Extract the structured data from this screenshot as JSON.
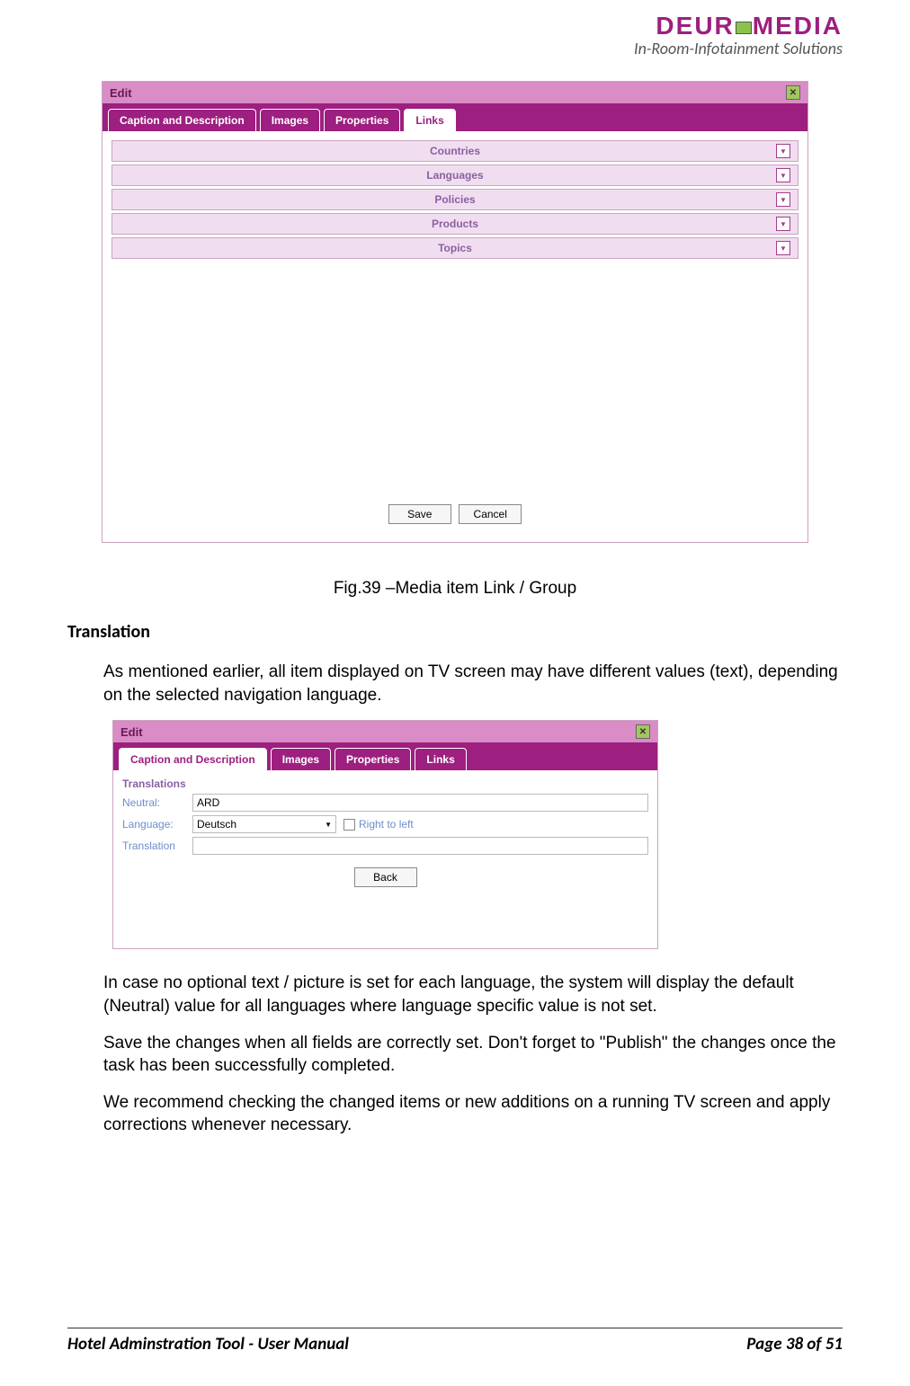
{
  "header": {
    "logo_text": "DEUR   MEDIA",
    "tagline": "In-Room-Infotainment Solutions"
  },
  "window1": {
    "title": "Edit",
    "tabs": [
      "Caption and Description",
      "Images",
      "Properties",
      "Links"
    ],
    "active_tab_index": 3,
    "link_rows": [
      "Countries",
      "Languages",
      "Policies",
      "Products",
      "Topics"
    ],
    "buttons": {
      "save": "Save",
      "cancel": "Cancel"
    }
  },
  "fig_caption": "Fig.39 –Media item Link / Group",
  "section_heading": "Translation",
  "paragraph1": "As mentioned earlier, all item displayed on TV screen may have different values (text), depending on the selected navigation language.",
  "window2": {
    "title": "Edit",
    "tabs": [
      "Caption and Description",
      "Images",
      "Properties",
      "Links"
    ],
    "active_tab_index": 0,
    "section_label": "Translations",
    "neutral_label": "Neutral:",
    "neutral_value": "ARD",
    "language_label": "Language:",
    "language_value": "Deutsch",
    "rtl_label": "Right to left",
    "translation_label": "Translation",
    "translation_value": "",
    "back_button": "Back"
  },
  "paragraph2": "In case no optional text / picture is set for each language, the system will display the default (Neutral) value for all languages where language specific value is not set.",
  "paragraph3": "Save the changes when all fields are correctly set. Don't forget to \"Publish\" the changes once the task has been successfully completed.",
  "paragraph4": "We recommend checking the changed items or new additions on a running TV screen and apply corrections whenever necessary.",
  "footer": {
    "left": "Hotel Adminstration Tool - User Manual",
    "right": "Page 38 of 51"
  }
}
